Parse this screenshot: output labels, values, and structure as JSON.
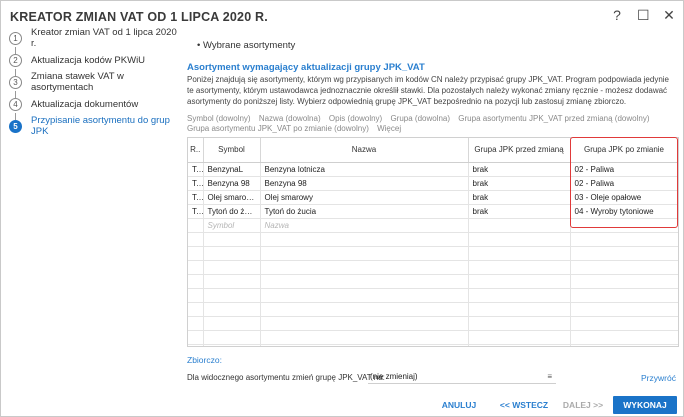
{
  "window": {
    "title": "KREATOR ZMIAN VAT OD 1 LIPCA 2020 R.",
    "buttons": {
      "help": "?",
      "maximize": "☐",
      "close": "✕"
    }
  },
  "sidebar": {
    "steps": [
      {
        "num": "1",
        "label": "Kreator zmian VAT od 1 lipca 2020 r."
      },
      {
        "num": "2",
        "label": "Aktualizacja kodów PKWiU"
      },
      {
        "num": "3",
        "label": "Zmiana stawek VAT w asortymentach"
      },
      {
        "num": "4",
        "label": "Aktualizacja dokumentów"
      },
      {
        "num": "5",
        "label": "Przypisanie asortymentu do grup JPK"
      }
    ]
  },
  "main": {
    "bullet_title": "• Wybrane asortymenty",
    "section_title": "Asortyment wymagający aktualizacji grupy JPK_VAT",
    "description": "Poniżej znajdują się asortymenty, którym wg przypisanych im kodów CN należy przypisać grupy JPK_VAT. Program podpowiada jedynie te asortymenty, którym ustawodawca jednoznacznie określił stawki. Dla pozostałych należy wykonać zmiany ręcznie - możesz dodawać asortymenty do poniższej listy. Wybierz odpowiednią grupę JPK_VAT bezpośrednio na pozycji lub zastosuj zmianę zbiorczo.",
    "filters": [
      "Symbol (dowolny)",
      "Nazwa (dowolna)",
      "Opis (dowolny)",
      "Grupa (dowolna)",
      "Grupa asortymentu JPK_VAT przed zmianą (dowolny)",
      "Grupa asortymentu JPK_VAT po zmianie (dowolny)",
      "Więcej"
    ]
  },
  "table": {
    "headers": [
      "R..",
      "Symbol",
      "Nazwa",
      "Grupa JPK przed zmianą",
      "Grupa JPK po zmianie"
    ],
    "rows": [
      [
        "T..",
        "BenzynaL",
        "Benzyna lotnicza",
        "brak",
        "02 - Paliwa"
      ],
      [
        "T..",
        "Benzyna 98",
        "Benzyna 98",
        "brak",
        "02 - Paliwa"
      ],
      [
        "T..",
        "Olej smarow...",
        "Olej smarowy",
        "brak",
        "03 - Oleje opałowe"
      ],
      [
        "T..",
        "Tytoń do żucia",
        "Tytoń do żucia",
        "brak",
        "04 - Wyroby tytoniowe"
      ]
    ],
    "new_row_placeholders": {
      "symbol": "Symbol",
      "nazwa": "Nazwa"
    }
  },
  "bulk": {
    "title": "Zbiorczo:",
    "label": "Dla widocznego asortymentu zmień grupę JPK_VAT na:",
    "value": "(nie zmieniaj)",
    "icon": "list-icon",
    "restore": "Przywróć"
  },
  "footer": {
    "cancel": "ANULUJ",
    "back": "<< WSTECZ",
    "next": "DALEJ >>",
    "execute": "WYKONAJ"
  },
  "colors": {
    "accent": "#1a73c8",
    "link": "#2a7fcf",
    "highlight": "#e03a3a"
  }
}
